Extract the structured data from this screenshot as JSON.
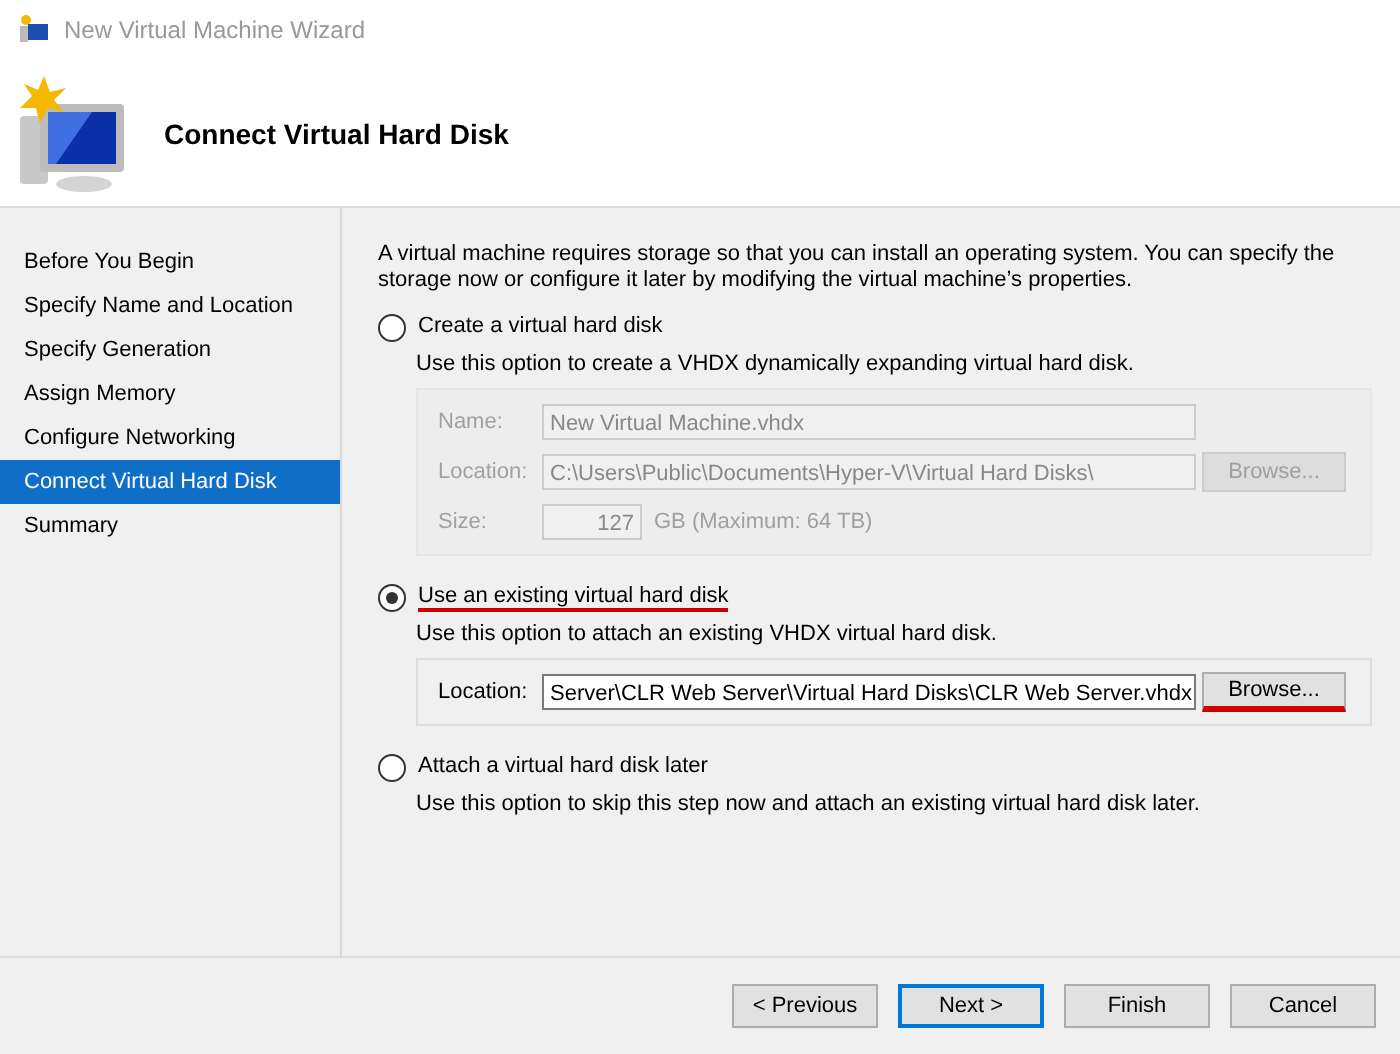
{
  "window": {
    "title": "New Virtual Machine Wizard"
  },
  "header": {
    "title": "Connect Virtual Hard Disk"
  },
  "sidebar": {
    "items": [
      {
        "label": "Before You Begin",
        "selected": false
      },
      {
        "label": "Specify Name and Location",
        "selected": false
      },
      {
        "label": "Specify Generation",
        "selected": false
      },
      {
        "label": "Assign Memory",
        "selected": false
      },
      {
        "label": "Configure Networking",
        "selected": false
      },
      {
        "label": "Connect Virtual Hard Disk",
        "selected": true
      },
      {
        "label": "Summary",
        "selected": false
      }
    ]
  },
  "intro": "A virtual machine requires storage so that you can install an operating system. You can specify the storage now or configure it later by modifying the virtual machine’s properties.",
  "options": [
    {
      "label": "Create a virtual hard disk",
      "selected": false,
      "underlined": false,
      "description": "Use this option to create a VHDX dynamically expanding virtual hard disk.",
      "group": {
        "disabled": true,
        "fields": [
          {
            "kind": "text",
            "label": "Name:",
            "value": "New Virtual Machine.vhdx"
          },
          {
            "kind": "browse",
            "label": "Location:",
            "value": "C:\\Users\\Public\\Documents\\Hyper-V\\Virtual Hard Disks\\",
            "button": "Browse...",
            "underlined": false
          },
          {
            "kind": "size",
            "label": "Size:",
            "value": "127",
            "suffix": "GB (Maximum: 64 TB)"
          }
        ]
      }
    },
    {
      "label": "Use an existing virtual hard disk",
      "selected": true,
      "underlined": true,
      "description": "Use this option to attach an existing VHDX virtual hard disk.",
      "group": {
        "disabled": false,
        "fields": [
          {
            "kind": "browse",
            "label": "Location:",
            "value": "Server\\CLR Web Server\\Virtual Hard Disks\\CLR Web Server.vhdx",
            "button": "Browse...",
            "underlined": true
          }
        ]
      }
    },
    {
      "label": "Attach a virtual hard disk later",
      "selected": false,
      "underlined": false,
      "description": "Use this option to skip this step now and attach an existing virtual hard disk later."
    }
  ],
  "buttons": [
    {
      "label": "< Previous",
      "default": false
    },
    {
      "label": "Next >",
      "default": true
    },
    {
      "label": "Finish",
      "default": false
    },
    {
      "label": "Cancel",
      "default": false
    }
  ]
}
